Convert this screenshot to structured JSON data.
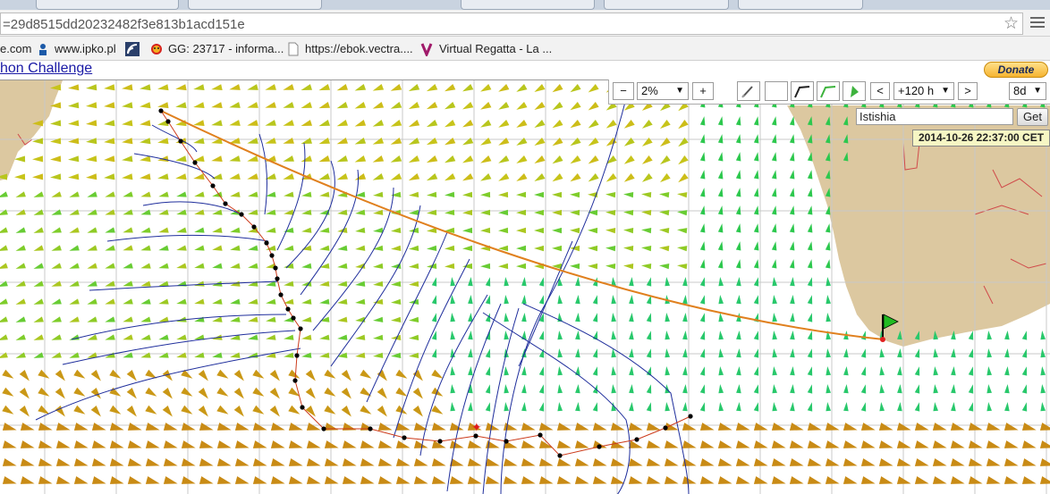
{
  "browser": {
    "url": "=29d8515dd20232482f3e813b1acd151e",
    "bookmarks": [
      {
        "label": "e.com"
      },
      {
        "label": "www.ipko.pl"
      },
      {
        "label": ""
      },
      {
        "label": "GG: 23717 - informa..."
      },
      {
        "label": "https://ebok.vectra...."
      },
      {
        "label": "Virtual Regatta - La ..."
      }
    ]
  },
  "page": {
    "title": "hon Challenge",
    "donate_label": "Donate"
  },
  "controls": {
    "zoom_out": "−",
    "zoom_value": "2%",
    "zoom_in": "+",
    "time_prev": "<",
    "time_value": "+120 h",
    "time_next": ">",
    "range_value": "8d",
    "search_value": "Istishia",
    "get_label": "Get",
    "timestamp": "2014-10-26 22:37:00 CET"
  },
  "colors": {
    "land": "#dcc8a0",
    "route_great_circle": "#e0801e",
    "route_track": "#cc3a1a",
    "isochrone": "#1f2e9c",
    "grid": "#c9c9c9",
    "finish_flag": "#22bb22"
  }
}
